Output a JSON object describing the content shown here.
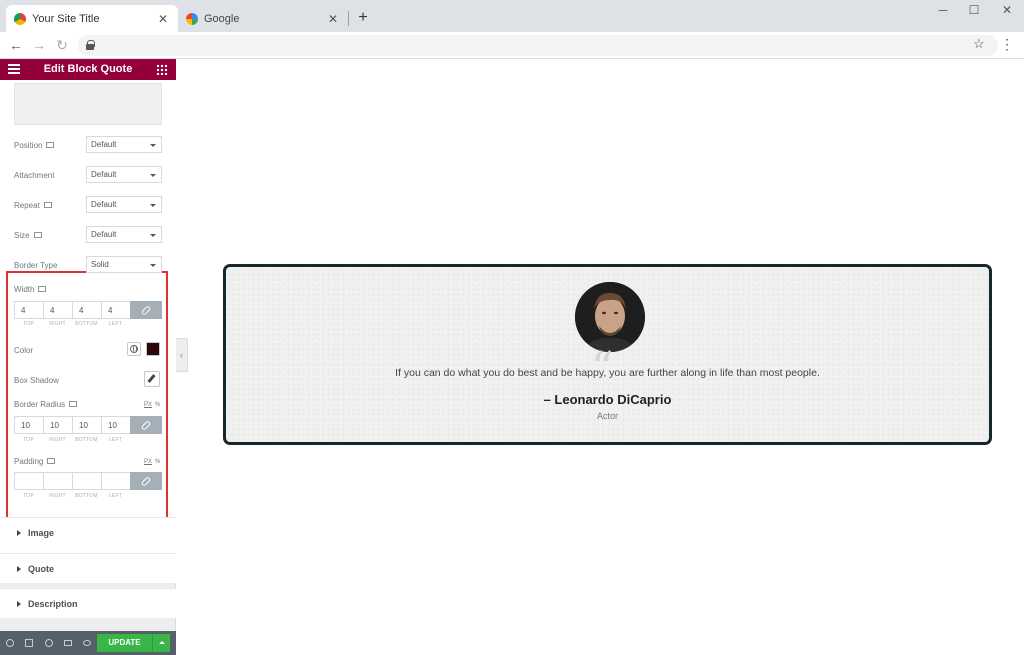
{
  "browser": {
    "tabs": [
      {
        "title": "Your Site Title",
        "active": true,
        "close": "✕"
      },
      {
        "title": "Google",
        "active": false,
        "close": "✕"
      }
    ],
    "new_tab": "+",
    "window": {
      "minimize": "─",
      "maximize": "☐",
      "close": "✕"
    },
    "nav": {
      "back": "←",
      "forward": "→",
      "reload": "↻"
    },
    "star": "☆",
    "menu": "⋮"
  },
  "panel": {
    "title": "Edit Block Quote",
    "background_fields": [
      {
        "label": "Position",
        "value": "Default",
        "responsive": true
      },
      {
        "label": "Attachment",
        "value": "Default",
        "responsive": false
      },
      {
        "label": "Repeat",
        "value": "Default",
        "responsive": true
      },
      {
        "label": "Size",
        "value": "Default",
        "responsive": true
      }
    ],
    "border_type": {
      "label": "Border Type",
      "value": "Solid"
    },
    "width": {
      "label": "Width",
      "values": [
        "4",
        "4",
        "4",
        "4"
      ]
    },
    "dim_labels": [
      "TOP",
      "RIGHT",
      "BOTTOM",
      "LEFT"
    ],
    "color": {
      "label": "Color",
      "value": "#2b0508"
    },
    "box_shadow": {
      "label": "Box Shadow"
    },
    "border_radius": {
      "label": "Border Radius",
      "unit": "PX",
      "alt_unit": "%",
      "values": [
        "10",
        "10",
        "10",
        "10"
      ]
    },
    "padding": {
      "label": "Padding",
      "unit": "PX",
      "alt_unit": "%",
      "values": [
        "",
        "",
        "",
        ""
      ]
    },
    "sections": [
      "Image",
      "Quote",
      "Description"
    ],
    "footer": {
      "update": "UPDATE"
    },
    "collapse": "‹"
  },
  "preview": {
    "quote_mark": "“",
    "text": "If you can do what you do best and be happy, you are further along in life than most people.",
    "author": "– Leonardo DiCaprio",
    "role": "Actor",
    "border_color": "#15282e"
  },
  "colors": {
    "accent": "#93003a",
    "update": "#39b54a",
    "highlight": "#e03131"
  }
}
